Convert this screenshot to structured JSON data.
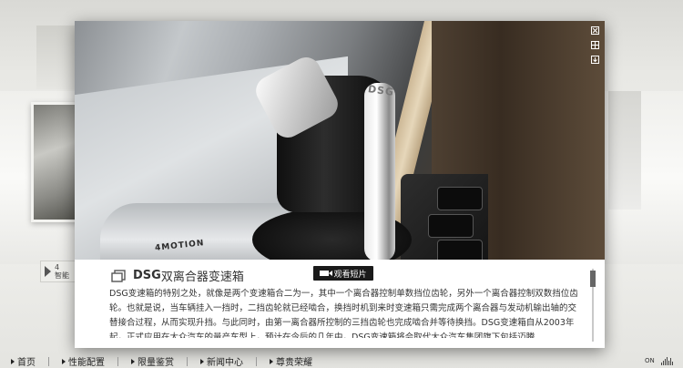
{
  "popup": {
    "controls": [
      {
        "name": "close-icon"
      },
      {
        "name": "grid-icon"
      },
      {
        "name": "download-icon"
      }
    ],
    "photo": {
      "knob_label": "DSG",
      "console_label": "4MOTION"
    },
    "title_dsg": "DSG",
    "title_rest": "双离合器变速箱",
    "video_button": "观看短片",
    "body": "DSG变速箱的特别之处，就像是两个变速箱合二为一，其中一个离合器控制单数挡位齿轮，另外一个离合器控制双数挡位齿轮。也就是说，当车辆挂入一挡时，二挡齿轮就已经啮合，换挡时机到来时变速箱只需完成两个离合器与发动机输出轴的交替接合过程，从而实现升挡。与此同时，由第一离合器所控制的三挡齿轮也完成啮合并等待换挡。DSG变速箱自从2003年起，正式应用在大众汽车的量产车型上，预计在今后的几年中，DSG变速箱将会取代大众汽车集团旗下包括迈腾"
  },
  "background": {
    "caption_text": "4\n智能"
  },
  "nav": {
    "items": [
      "首页",
      "性能配置",
      "限量鉴赏",
      "新闻中心",
      "尊贵荣耀"
    ],
    "sound_label": "ON"
  }
}
